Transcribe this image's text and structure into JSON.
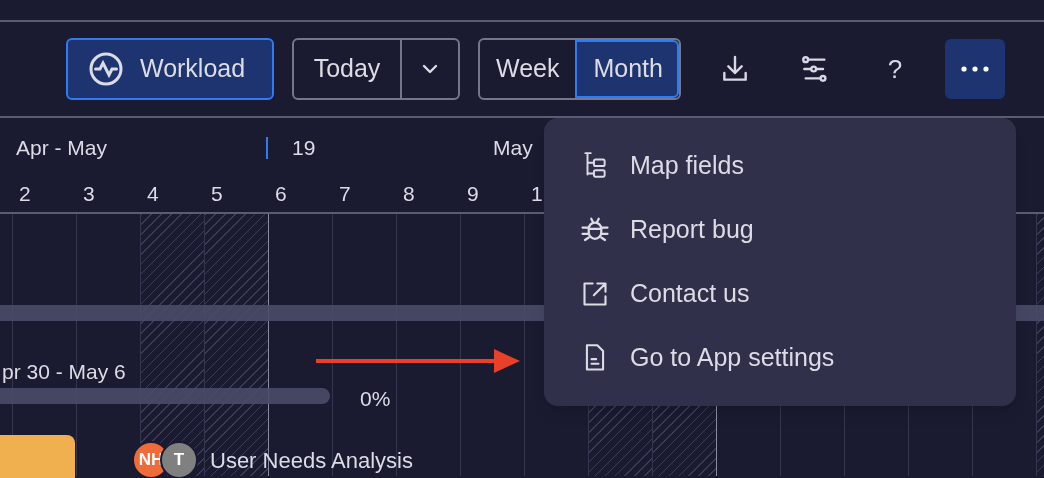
{
  "toolbar": {
    "workload": {
      "label": "Workload",
      "selected": true
    },
    "today": {
      "label": "Today"
    },
    "views": [
      {
        "label": "Week",
        "selected": false
      },
      {
        "label": "Month",
        "selected": true
      }
    ],
    "icon_buttons": [
      {
        "kind": "download"
      },
      {
        "kind": "filter"
      },
      {
        "kind": "help",
        "label": "?"
      },
      {
        "kind": "more",
        "selected": true
      }
    ]
  },
  "timeline": {
    "periods": [
      {
        "label": "Apr - May",
        "marker": false
      },
      {
        "label": "19",
        "marker": true
      },
      {
        "label": "May",
        "marker": false
      }
    ],
    "columns": [
      {
        "label": "2",
        "weekend": false,
        "week_start": false
      },
      {
        "label": "3",
        "weekend": false,
        "week_start": false
      },
      {
        "label": "4",
        "weekend": true,
        "week_start": false
      },
      {
        "label": "5",
        "weekend": true,
        "week_start": false
      },
      {
        "label": "6",
        "weekend": false,
        "week_start": true
      },
      {
        "label": "7",
        "weekend": false,
        "week_start": false
      },
      {
        "label": "8",
        "weekend": false,
        "week_start": false
      },
      {
        "label": "9",
        "weekend": false,
        "week_start": false
      },
      {
        "label": "1",
        "weekend": false,
        "week_start": false
      },
      {
        "weekend": true,
        "week_start": false
      },
      {
        "weekend": true,
        "week_start": false
      },
      {
        "weekend": false,
        "week_start": true
      },
      {
        "weekend": false,
        "week_start": false
      },
      {
        "weekend": false,
        "week_start": false
      },
      {
        "weekend": false,
        "week_start": false
      },
      {
        "weekend": false,
        "week_start": false
      },
      {
        "weekend": true,
        "week_start": false
      }
    ]
  },
  "tasks": [
    {
      "kind": "summary"
    },
    {
      "kind": "task",
      "dates": "pr 30 - May 6",
      "progress": "0%"
    },
    {
      "kind": "active",
      "title": "User Needs Analysis",
      "assignees": [
        {
          "initials": "NH",
          "color": "#ef6c3a"
        },
        {
          "initials": "T",
          "color": "#808080"
        }
      ]
    }
  ],
  "menu": {
    "items": [
      {
        "kind": "map",
        "label": "Map fields"
      },
      {
        "kind": "bug",
        "label": "Report bug"
      },
      {
        "kind": "external",
        "label": "Contact us"
      },
      {
        "kind": "file",
        "label": "Go to App settings"
      }
    ]
  }
}
